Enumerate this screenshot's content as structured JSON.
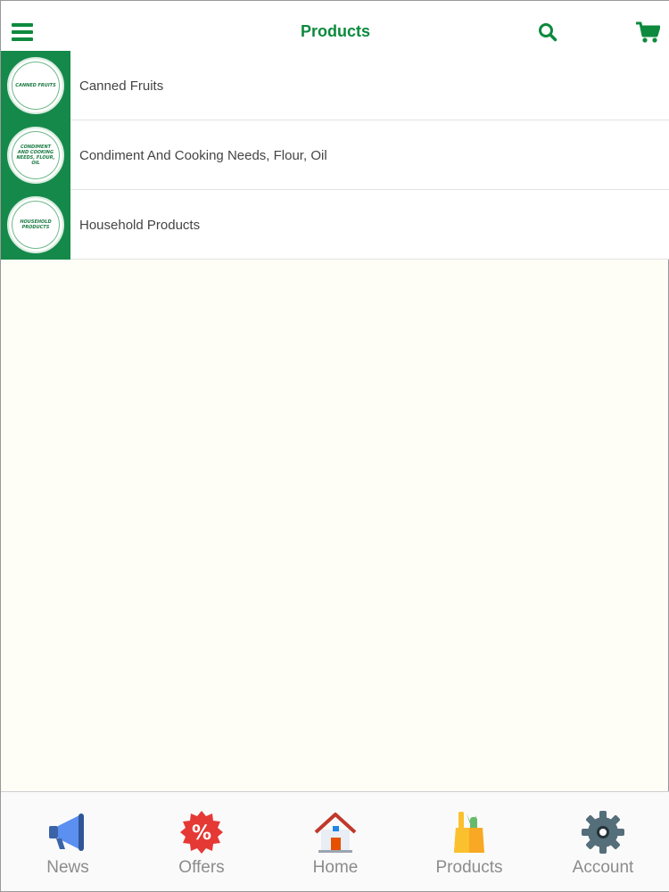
{
  "header": {
    "title": "Products",
    "menu_icon": "hamburger-menu-icon",
    "search_icon": "search-icon",
    "cart_icon": "cart-icon",
    "accent_color": "#0d8a3d"
  },
  "categories": [
    {
      "label": "Canned Fruits",
      "thumb_text": "Canned Fruits"
    },
    {
      "label": "Condiment And Cooking Needs, Flour, Oil",
      "thumb_text": "Condiment And Cooking Needs, Flour, Oil"
    },
    {
      "label": "Household Products",
      "thumb_text": "Household Products"
    }
  ],
  "tabbar": {
    "items": [
      {
        "label": "News",
        "icon": "megaphone-icon"
      },
      {
        "label": "Offers",
        "icon": "discount-badge-icon"
      },
      {
        "label": "Home",
        "icon": "house-icon"
      },
      {
        "label": "Products",
        "icon": "grocery-bag-icon"
      },
      {
        "label": "Account",
        "icon": "gear-icon"
      }
    ]
  }
}
